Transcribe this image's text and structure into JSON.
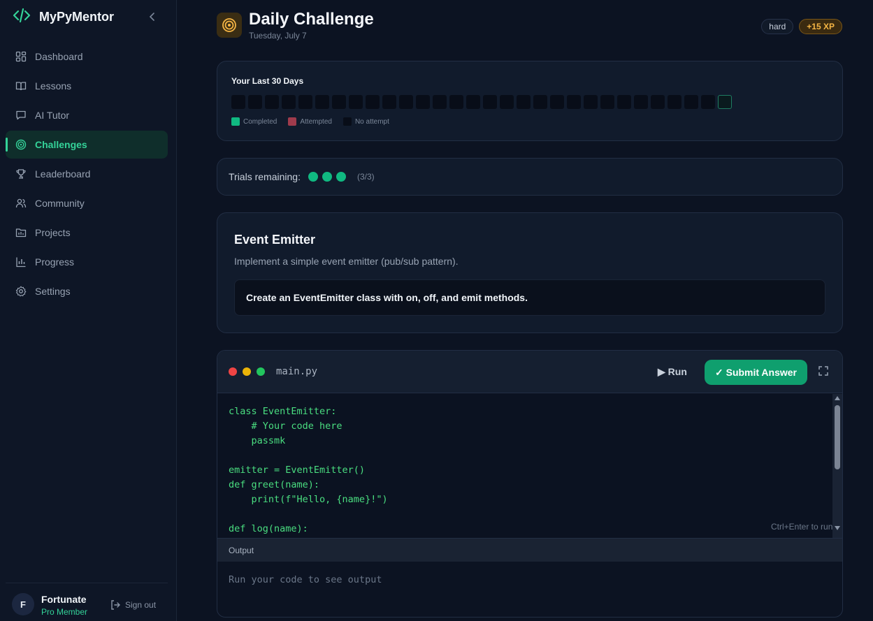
{
  "app": {
    "name": "MyPyMentor"
  },
  "sidebar": {
    "items": [
      {
        "label": "Dashboard",
        "icon": "dashboard-icon"
      },
      {
        "label": "Lessons",
        "icon": "book-icon"
      },
      {
        "label": "AI Tutor",
        "icon": "chat-icon"
      },
      {
        "label": "Challenges",
        "icon": "target-icon",
        "active": true
      },
      {
        "label": "Leaderboard",
        "icon": "trophy-icon"
      },
      {
        "label": "Community",
        "icon": "users-icon"
      },
      {
        "label": "Projects",
        "icon": "folder-icon"
      },
      {
        "label": "Progress",
        "icon": "bar-chart-icon"
      },
      {
        "label": "Settings",
        "icon": "gear-icon"
      }
    ],
    "user": {
      "initial": "F",
      "name": "Fortunate",
      "plan": "Pro Member"
    },
    "signout_label": "Sign out"
  },
  "header": {
    "title": "Daily Challenge",
    "date": "Tuesday, July 7",
    "difficulty": "hard",
    "xp": "+15 XP"
  },
  "history": {
    "title": "Your Last 30 Days",
    "days": 30,
    "legend": [
      {
        "label": "Completed",
        "color": "#10b981"
      },
      {
        "label": "Attempted",
        "color": "#9f3b4c"
      },
      {
        "label": "No attempt",
        "color": "#080d18"
      }
    ]
  },
  "trials": {
    "label": "Trials remaining:",
    "remaining": 3,
    "count_text": "(3/3)"
  },
  "problem": {
    "title": "Event Emitter",
    "description": "Implement a simple event emitter (pub/sub pattern).",
    "task": "Create an EventEmitter class with on, off, and emit methods."
  },
  "editor": {
    "filename": "main.py",
    "run_label": "▶ Run",
    "submit_label": "✓ Submit Answer",
    "code_lines": [
      "class EventEmitter:",
      "    # Your code here",
      "    passmk",
      "",
      "emitter = EventEmitter()",
      "def greet(name):",
      "    print(f\"Hello, {name}!\")",
      "",
      "def log(name):"
    ],
    "hint": "Ctrl+Enter to run",
    "output_label": "Output",
    "output_placeholder": "Run your code to see output"
  },
  "colors": {
    "accent": "#34d399",
    "submit": "#0f9f6e",
    "xp": "#f5b544"
  }
}
